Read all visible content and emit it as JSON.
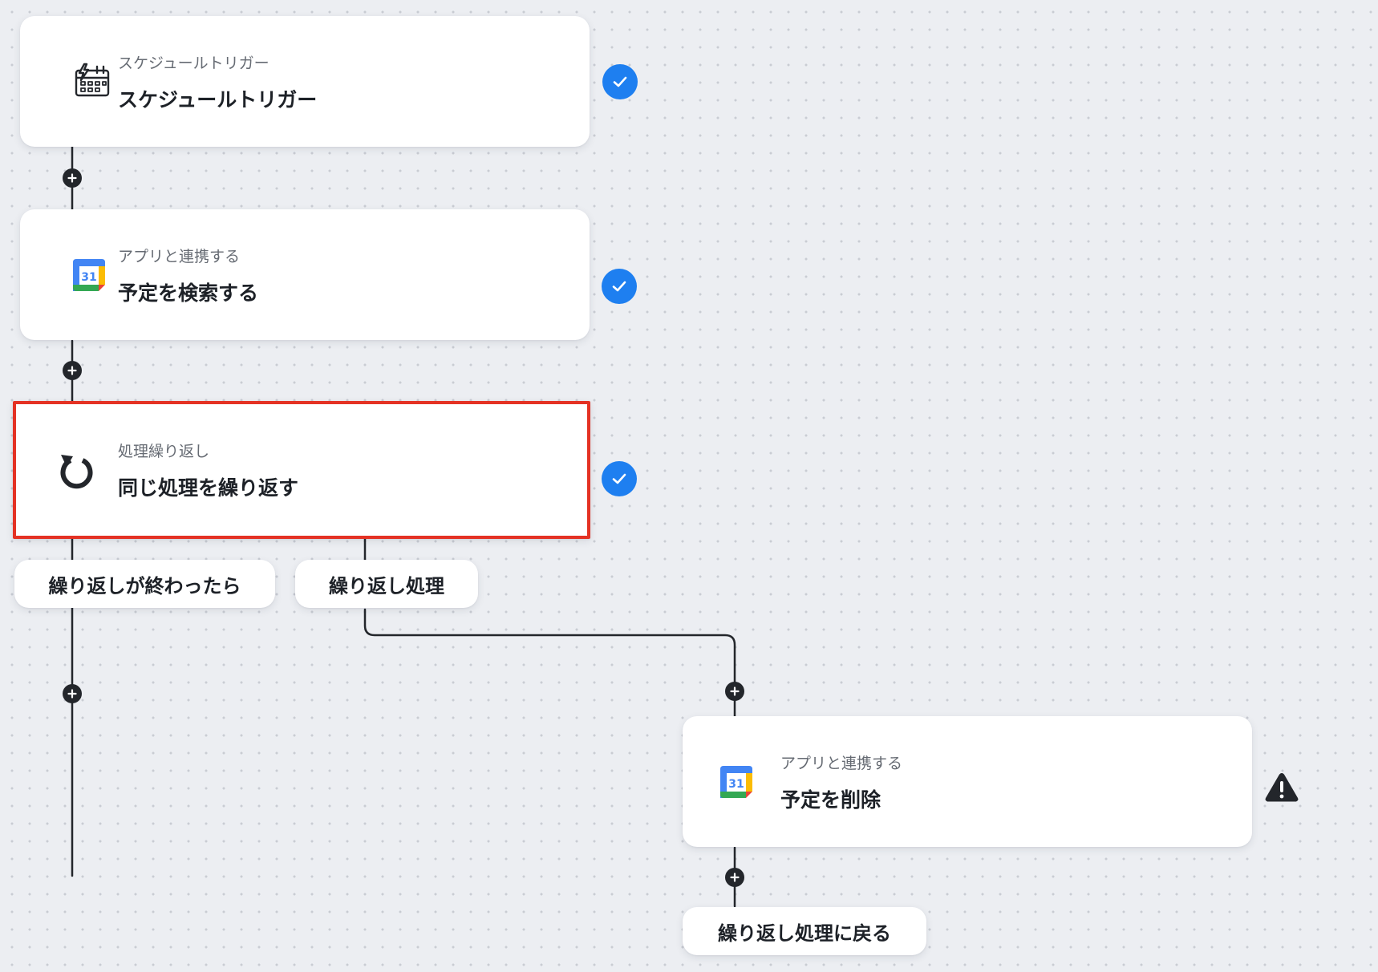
{
  "canvas": {
    "background": "#eceef2",
    "accent": "#1e7ff0",
    "selection_color": "#e43224"
  },
  "steps": [
    {
      "category": "スケジュールトリガー",
      "title": "スケジュールトリガー",
      "icon": "schedule-calendar-icon",
      "status": "complete"
    },
    {
      "category": "アプリと連携する",
      "title": "予定を検索する",
      "icon": "google-calendar-icon",
      "icon_text": "31",
      "status": "complete"
    },
    {
      "category": "処理繰り返し",
      "title": "同じ処理を繰り返す",
      "icon": "loop-icon",
      "status": "complete",
      "selected": true
    },
    {
      "category": "アプリと連携する",
      "title": "予定を削除",
      "icon": "google-calendar-icon",
      "icon_text": "31",
      "status": "warning"
    }
  ],
  "branches": {
    "after_loop": "繰り返しが終わったら",
    "loop_body": "繰り返し処理",
    "return_to_loop": "繰り返し処理に戻る"
  }
}
